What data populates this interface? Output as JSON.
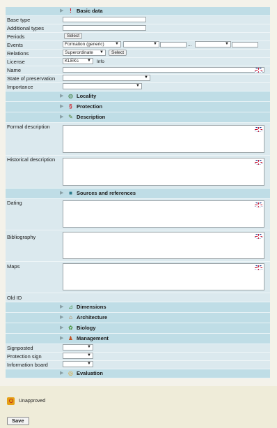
{
  "sections": {
    "basic": "Basic data",
    "locality": "Locality",
    "protection": "Protection",
    "description": "Description",
    "sources": "Sources and references",
    "dimensions": "Dimensions",
    "architecture": "Architecture",
    "biology": "Biology",
    "management": "Management",
    "evaluation": "Evaluation"
  },
  "fields": {
    "base_type": "Base type",
    "additional_types": "Additional types",
    "periods": "Periods",
    "events": "Events",
    "relations": "Relations",
    "license": "License",
    "name": "Name",
    "state": "State of preservation",
    "importance": "Importance",
    "formal_description": "Formal description",
    "historical_description": "Historical description",
    "dating": "Dating",
    "bibliography": "Bibliography",
    "maps": "Maps",
    "old_id": "Old ID",
    "signposted": "Signposted",
    "protection_sign": "Protection sign",
    "information_board": "Information board"
  },
  "controls": {
    "select_label": "Select",
    "events_value": "Formation (generic)",
    "relations_value": "Superordinate",
    "license_value": "KLEKs",
    "info_label": "Info",
    "events_dash": "..."
  },
  "status": {
    "label": "Unapproved"
  },
  "save_label": "Save",
  "colors": {
    "section_bg": "#bfdde6",
    "row_bg": "#dbe9ee",
    "page_bg": "#f4f2ea"
  }
}
